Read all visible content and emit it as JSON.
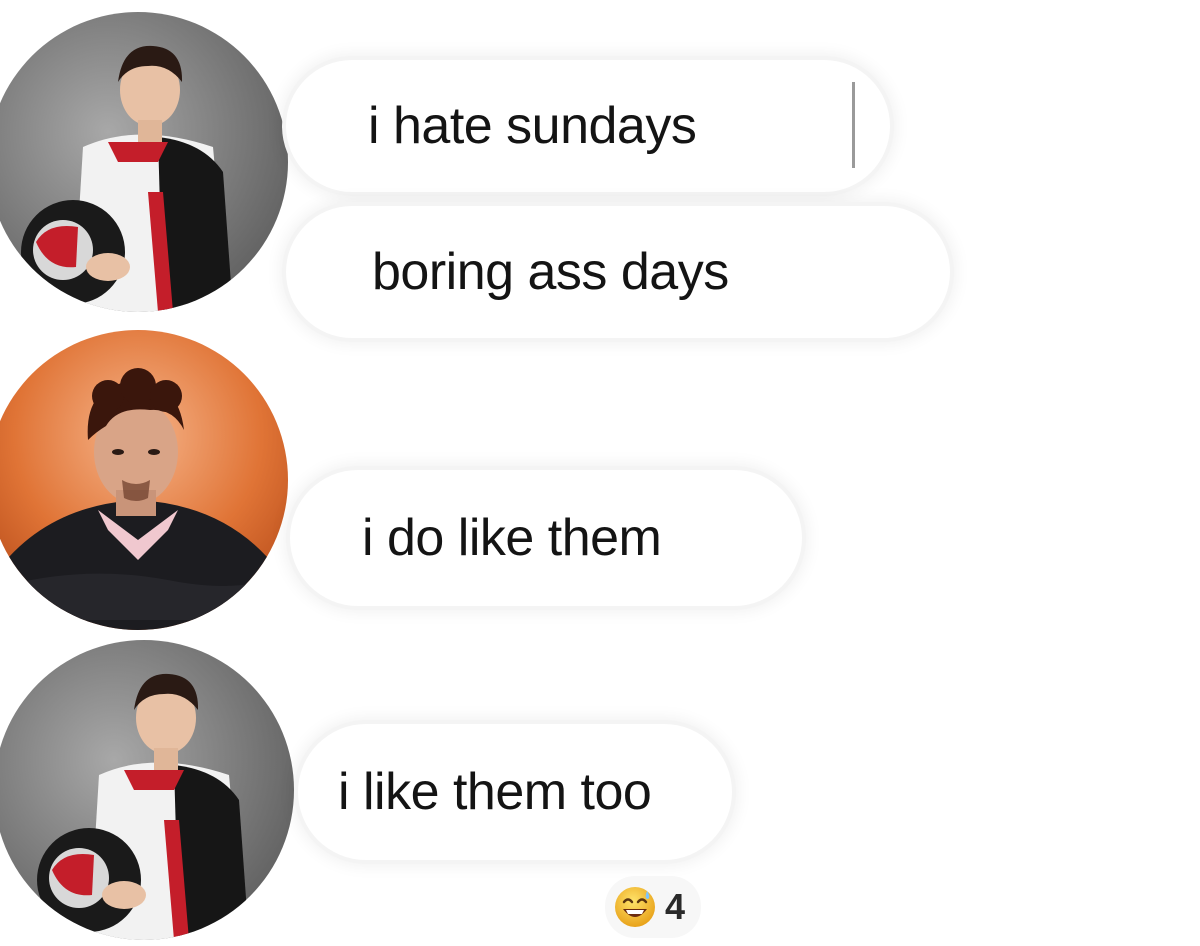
{
  "messages": [
    {
      "text": "i hate sundays",
      "avatar": "driver-white-racesuit-helmet"
    },
    {
      "text": "boring ass days",
      "avatar": "driver-white-racesuit-helmet"
    },
    {
      "text": "i do like them",
      "avatar": "driver-orange-background"
    },
    {
      "text": "i like them too",
      "avatar": "driver-white-racesuit-helmet"
    }
  ],
  "reaction": {
    "icon": "grinning-sweat-emoji",
    "count": "4"
  },
  "colors": {
    "bubble_background": "#ffffff",
    "bubble_outline": "#f4f4f4",
    "text": "#141414",
    "avatar_orange": "#e06a2c",
    "avatar_gray": "#7e7e7e"
  }
}
